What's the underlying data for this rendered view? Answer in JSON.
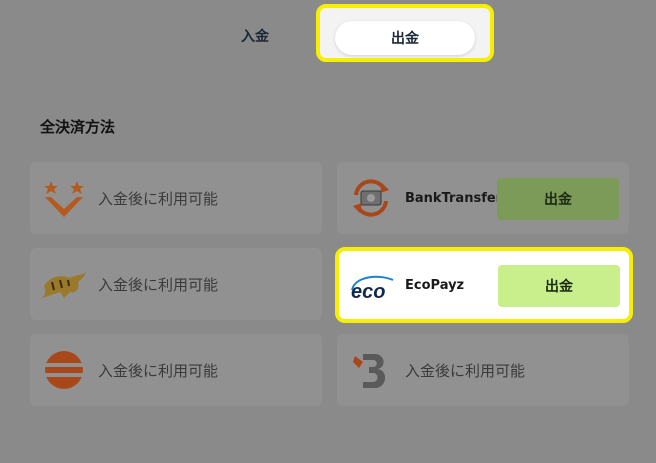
{
  "tabs": {
    "deposit": "入金",
    "withdraw": "出金"
  },
  "section_title": "全決済方法",
  "unavailable_text": "入金後に利用可能",
  "methods": {
    "bank_transfer": {
      "name": "BankTransfer",
      "button": "出金"
    },
    "ecopayz": {
      "name": "EcoPayz",
      "logo_text": "eco",
      "button": "出金"
    }
  },
  "colors": {
    "overlay": "#8a8a8a",
    "highlight": "#f6f000",
    "button_dim": "#7c9a58",
    "button_bright": "#c9ee8c"
  }
}
